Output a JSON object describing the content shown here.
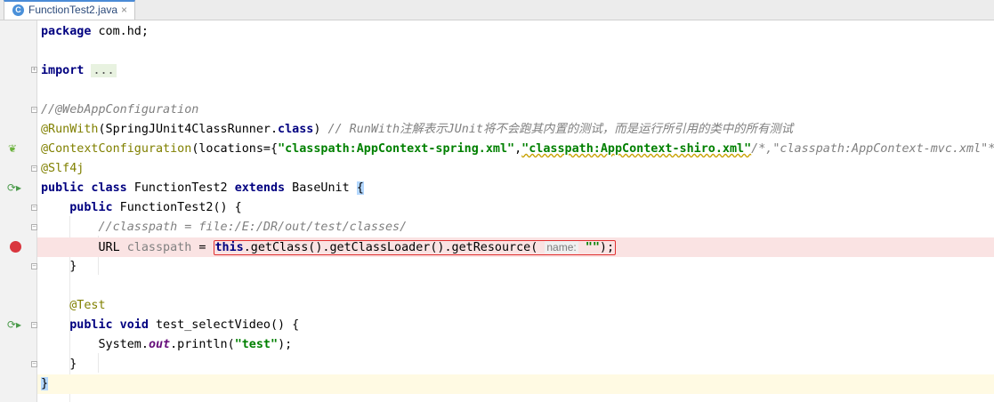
{
  "tab": {
    "label": "FunctionTest2.java",
    "icon": "java-class-icon",
    "close": "×",
    "icon_letter": "C"
  },
  "code": {
    "l1_kw": "package",
    "l1_rest": " com.hd;",
    "l3_kw": "import",
    "l3_fold": "...",
    "l5_cmt": "//@WebAppConfiguration",
    "l6_ann": "@RunWith",
    "l6_a": "(SpringJUnit4ClassRunner.",
    "l6_kw": "class",
    "l6_b": ") ",
    "l6_cmt": "// RunWith注解表示JUnit将不会跑其内置的测试，而是运行所引用的类中的所有测试",
    "l7_ann": "@ContextConfiguration",
    "l7_a": "(locations={",
    "l7_s1": "\"classpath:AppContext-spring.xml\"",
    "l7_c": ",",
    "l7_s2": "\"classpath:AppContext-shiro.xml\"",
    "l7_cmt": "/*,\"classpath:AppContext-mvc.xml\"*/",
    "l8_ann": "@Slf4j",
    "l9_kw1": "public class",
    "l9_name": " FunctionTest2 ",
    "l9_kw2": "extends",
    "l9_base": " BaseUnit ",
    "l9_brace": "{",
    "l10_kw": "public",
    "l10_rest": " FunctionTest2() {",
    "l11_cmt": "//classpath = file:/E:/DR/out/test/classes/",
    "l12_type": "URL ",
    "l12_var": "classpath",
    "l12_eq": " = ",
    "l12_this": "this",
    "l12_call": ".getClass().getClassLoader().getResource(",
    "l12_hint": "name:",
    "l12_str": "\"\"",
    "l12_end": ");",
    "l13": "}",
    "l15_ann": "@Test",
    "l16_kw": "public void",
    "l16_rest": " test_selectVideo() {",
    "l17_a": "System.",
    "l17_out": "out",
    "l17_b": ".println(",
    "l17_str": "\"test\"",
    "l17_c": ");",
    "l18": "}",
    "l19": "}"
  },
  "gutter_icons": {
    "spring": "spring-bean-icon",
    "run_class": "run-test-icon",
    "breakpoint": "breakpoint-icon",
    "run_method": "run-test-icon"
  },
  "colors": {
    "keyword": "#000080",
    "annotation": "#808000",
    "comment": "#808080",
    "string": "#008000",
    "breakpoint": "#d9363e",
    "highlight": "#e03030"
  }
}
